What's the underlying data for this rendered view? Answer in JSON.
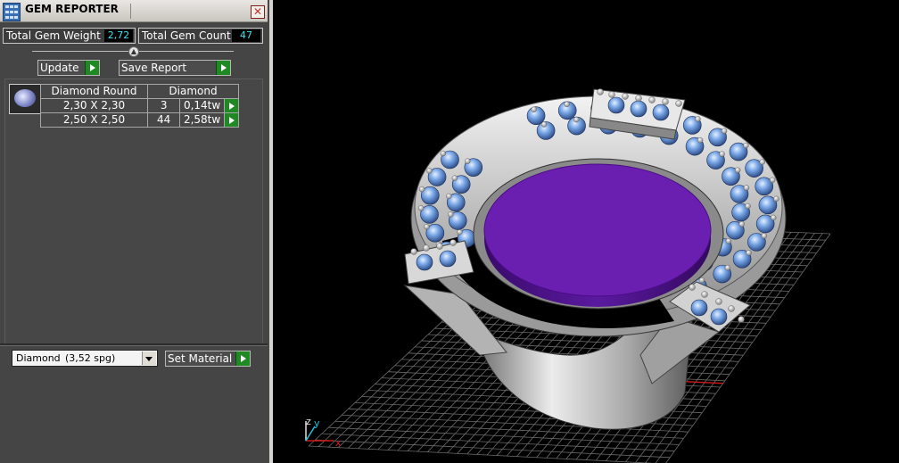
{
  "window": {
    "title": "GEM REPORTER",
    "close_glyph": "✕"
  },
  "stats": {
    "weight_label": "Total Gem Weight",
    "weight_value": "2,72",
    "count_label": "Total Gem Count",
    "count_value": "47"
  },
  "toolbar": {
    "update_label": "Update",
    "save_label": "Save Report"
  },
  "gem_table": {
    "headers": [
      "Diamond Round",
      "Diamond"
    ],
    "rows": [
      {
        "size": "2,30 X 2,30",
        "count": "3",
        "weight": "0,14tw"
      },
      {
        "size": "2,50 X 2,50",
        "count": "44",
        "weight": "2,58tw"
      }
    ]
  },
  "material": {
    "selected": "Diamond",
    "spg": "(3,52 spg)",
    "set_label": "Set Material"
  },
  "viewport": {
    "axis_x": "x",
    "axis_y": "y",
    "axis_z": "z"
  },
  "colors": {
    "panel_bg": "#454545",
    "readout_text": "#39e6f0",
    "play_button": "#1f8a24",
    "gem_blue": "#6f9fe0",
    "stone_purple": "#6a1fb0",
    "metal": "#bdbdbd",
    "grid": "#6a6a6a",
    "axis_red": "#d01818"
  },
  "icons": [
    "gem-reporter-app-icon",
    "close-icon",
    "slider-collapse-icon",
    "play-arrow-icon",
    "diamond-thumbnail-icon",
    "dropdown-arrow-icon"
  ]
}
